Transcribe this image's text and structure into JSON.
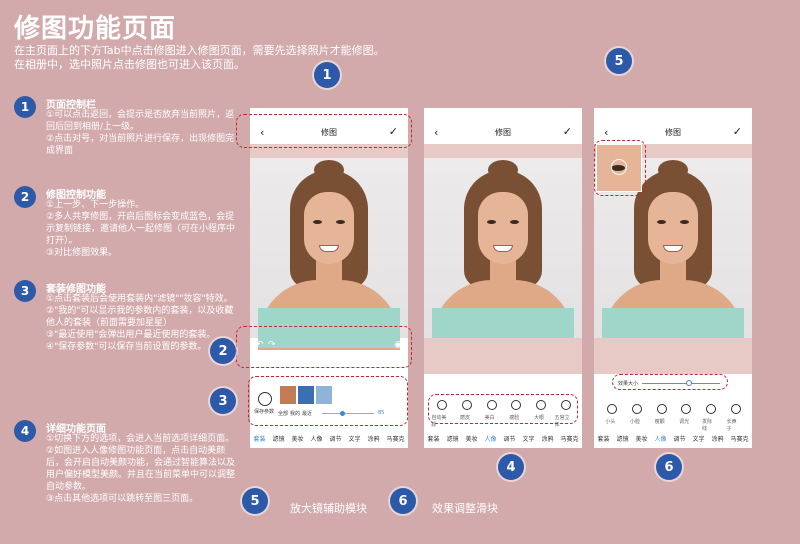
{
  "title": "修图功能页面",
  "subtitle": "在主页面上的下方Tab中点击修图进入修图页面，需要先选择照片才能修图。\n在相册中，选中照片点击修图也可进入该页面。",
  "annotations": [
    {
      "num": "1",
      "head": "页面控制栏",
      "body": "①可以点击返回，会提示是否放弃当前照片，返回后回到相册/上一级。\n②点击对号，对当前照片进行保存，出现修图完成界面"
    },
    {
      "num": "2",
      "head": "修图控制功能",
      "body": "①上一步、下一步操作。\n②多人共享修图，开启后图标会变成蓝色，会提示复制链接，邀请他人一起修图（可在小程序中打开）。\n③对比修图效果。"
    },
    {
      "num": "3",
      "head": "套装修图功能",
      "body": "①点击套装后会使用套装内\"滤镜\"\"妆容\"特效。\n②\"我的\"可以显示我的参数内的套装，以及收藏他人的套装（前面需要加星星）\n③\"最近使用\"会弹出用户最近使用的套装。\n④\"保存参数\"可以保存当前设置的参数。"
    },
    {
      "num": "4",
      "head": "详细功能页面",
      "body": "①切换下方的选项，会进入当前选项详细页面。\n②如图进入人像修图功能页面，点击自动美颜后，会开启自动美颜功能，会通过智能算法以及用户偏好模型美颜。并且在当前菜单中可以调整自动参数。\n③点击其他选项可以跳转至图三页面。"
    }
  ],
  "badges": [
    "1",
    "2",
    "3",
    "4",
    "5",
    "6"
  ],
  "bottom_labels": [
    {
      "num": "5",
      "text": "放大镜辅助模块"
    },
    {
      "num": "6",
      "text": "效果调整滑块"
    }
  ],
  "phones": [
    {
      "nav_title": "修图",
      "back": "‹",
      "ok": "✓",
      "tabs": [
        "套装",
        "滤镜",
        "美妆",
        "人像",
        "调节",
        "文字",
        "涂鸦",
        "马赛克"
      ],
      "active_tab": "套装"
    },
    {
      "nav_title": "修图",
      "back": "‹",
      "ok": "✓",
      "tabs": [
        "套装",
        "滤镜",
        "美妆",
        "人像",
        "调节",
        "文字",
        "涂鸦",
        "马赛克"
      ],
      "active_tab": "人像"
    },
    {
      "nav_title": "修图",
      "back": "‹",
      "ok": "✓",
      "tabs": [
        "套装",
        "滤镜",
        "美妆",
        "人像",
        "调节",
        "文字",
        "涂鸦",
        "马赛克"
      ],
      "active_tab": "人像"
    }
  ],
  "phone1_strip": {
    "save_label": "保存参数",
    "tab_labels": [
      "全部",
      "我的",
      "最近"
    ],
    "slider_value": "85"
  },
  "phone2_options": [
    "自动美颜",
    "磨皮",
    "美白",
    "瘦脸",
    "大眼",
    "五官立体"
  ],
  "phone3_options": [
    "小头",
    "小脸",
    "瘦颧",
    "调光",
    "发际线",
    "长鼻子"
  ],
  "phone3_slider_label": "效果大小",
  "colors": {
    "background": "#d2aaac",
    "accent": "#2d5aa8",
    "highlight": "#c9242a",
    "active_tab": "#3a86d6"
  }
}
